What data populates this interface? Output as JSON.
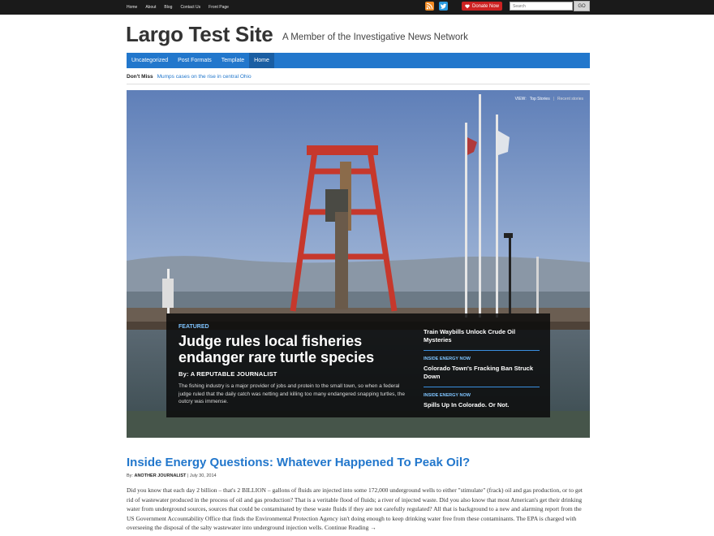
{
  "topbar": {
    "nav": [
      "Home",
      "About",
      "Blog",
      "Contact Us",
      "Front Page"
    ],
    "donate_label": "Donate Now",
    "search_placeholder": "Search",
    "go_label": "GO",
    "icons": [
      "rss-icon",
      "twitter-icon",
      "heart-icon"
    ]
  },
  "site": {
    "title": "Largo Test Site",
    "tagline": "A Member of the Investigative News Network"
  },
  "mainnav": [
    "Uncategorized",
    "Post Formats",
    "Template",
    "Home"
  ],
  "dontmiss": {
    "label": "Don't Miss",
    "link": "Mumps cases on the rise in central Ohio"
  },
  "hero": {
    "view_label": "VIEW:",
    "view_top": "Top Stories",
    "view_recent": "Recent stories",
    "kicker": "FEATURED",
    "headline": "Judge rules local fisheries endanger rare turtle species",
    "byline": "By: A REPUTABLE JOURNALIST",
    "excerpt": "The fishing industry is a major provider of jobs and protein to the small town, so when a federal judge ruled that the daily catch was netting and killing too many endangered snapping turtles, the outcry was immense.",
    "side_stories": [
      {
        "kicker": "",
        "title": "Train Waybills Unlock Crude Oil Mysteries"
      },
      {
        "kicker": "INSIDE ENERGY NOW",
        "title": "Colorado Town's Fracking Ban Struck Down"
      },
      {
        "kicker": "INSIDE ENERGY NOW",
        "title": "Spills Up In Colorado. Or Not."
      }
    ]
  },
  "post": {
    "title": "Inside Energy Questions: Whatever Happened To Peak Oil?",
    "by_prefix": "By:",
    "author": "ANOTHER JOURNALIST",
    "date": "| July 30, 2014",
    "body": "Did you know that each day 2 billion – that's 2 BILLION – gallons of fluids are injected into some 172,000 underground wells to either \"stimulate\" (frack) oil and gas production, or to get rid of wastewater produced in the process of oil and gas production? That is a veritable flood of fluids; a river of injected waste. Did you also know that most American's get their drinking water from underground sources, sources that could be contaminated by these waste fluids if they are not carefully regulated? All that is background to a new and alarming report from the US Government Accountability Office that finds the Environmental Protection Agency isn't doing enough to keep drinking water free from these contaminants. The EPA is charged with overseeing the disposal of the salty wastewater into underground injection wells. Continue Reading →"
  }
}
